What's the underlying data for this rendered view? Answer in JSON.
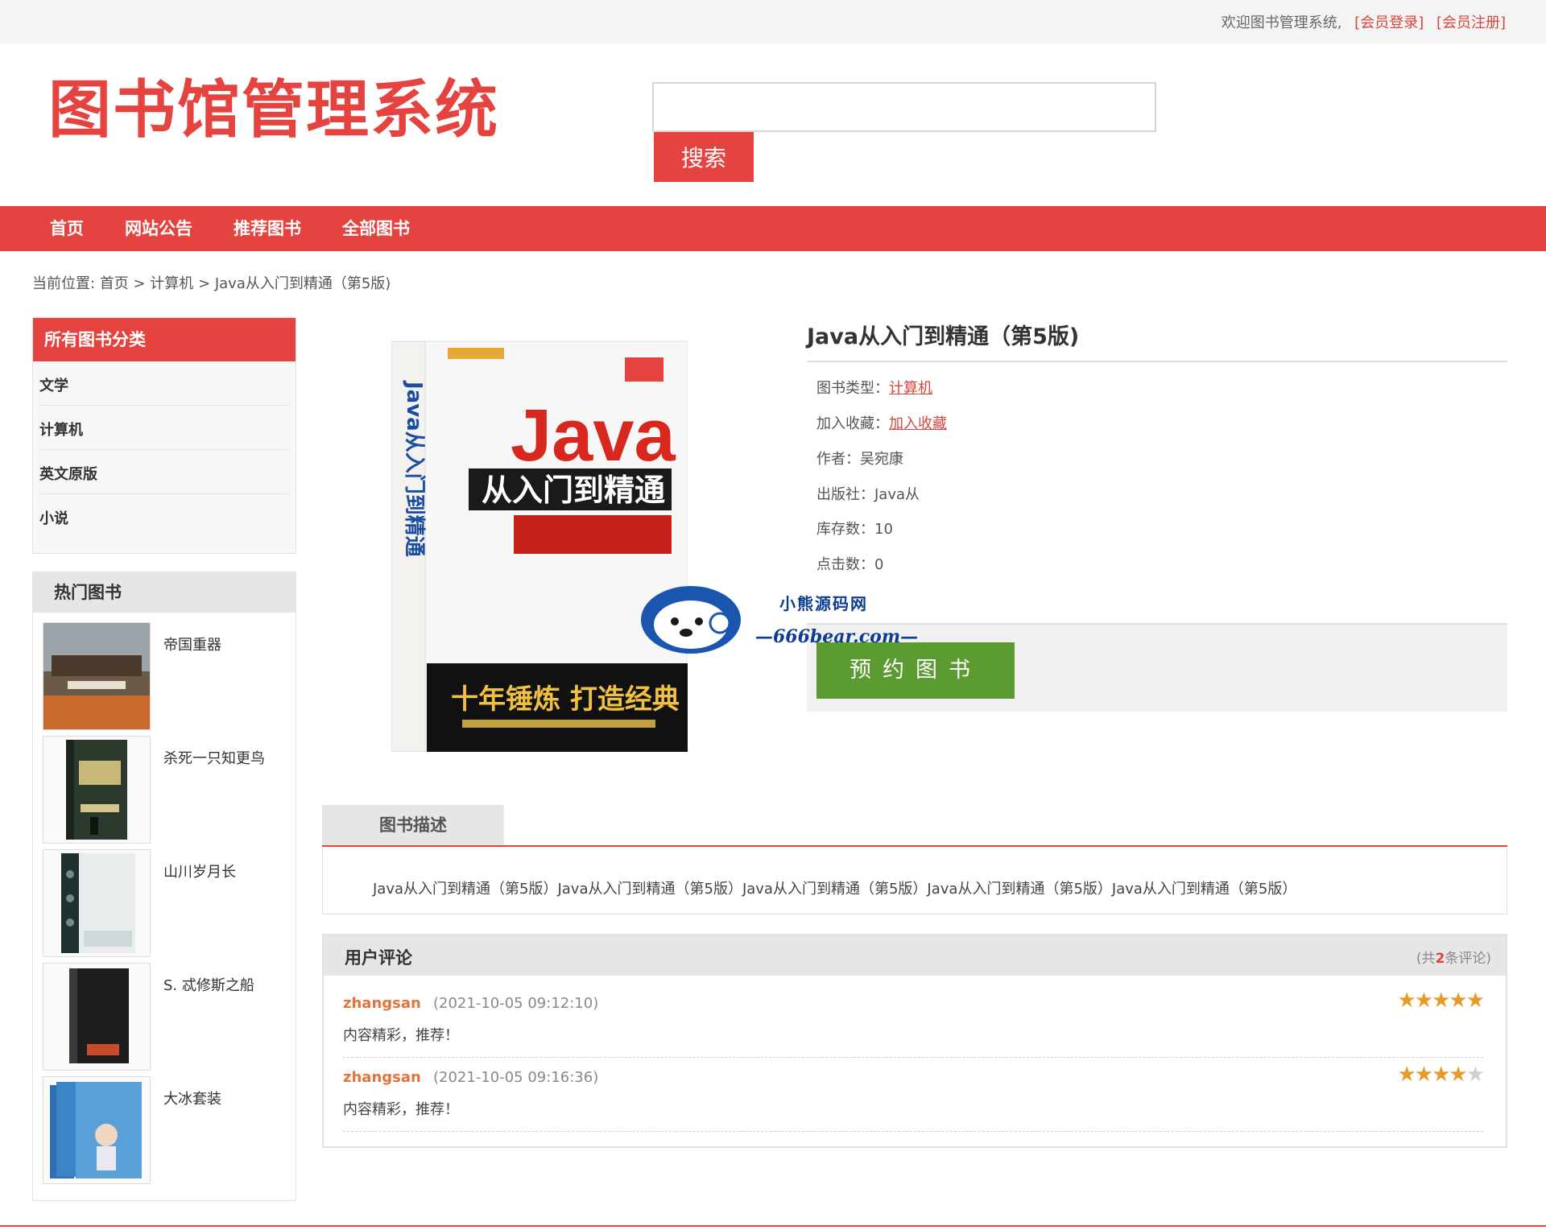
{
  "topbar": {
    "welcome": "欢迎图书管理系统,",
    "login": "[会员登录]",
    "register": "[会员注册]"
  },
  "header": {
    "logo_text": "图书馆管理系统",
    "search_placeholder": "",
    "search_button": "搜索"
  },
  "nav": {
    "items": [
      "首页",
      "网站公告",
      "推荐图书",
      "全部图书"
    ]
  },
  "breadcrumb": "当前位置: 首页 >  计算机 >  Java从入门到精通（第5版)",
  "sidebar": {
    "category_title": "所有图书分类",
    "categories": [
      "文学",
      "计算机",
      "英文原版",
      "小说"
    ],
    "hot_title": "热门图书",
    "hot_books": [
      "帝国重器",
      "杀死一只知更鸟",
      "山川岁月长",
      "S. 忒修斯之船",
      "大冰套装"
    ]
  },
  "book": {
    "title": "Java从入门到精通（第5版)",
    "cover": {
      "spine": "Java从入门到精通",
      "title_big": "Java",
      "subtitle": "从入门到精通",
      "slogan": "十年锤炼 打造经典"
    },
    "type_label": "图书类型：",
    "type_value": "计算机",
    "fav_label": "加入收藏：",
    "fav_value": "加入收藏",
    "author_label": "作者：",
    "author_value": "吴宛康",
    "publisher_label": "出版社：",
    "publisher_value": "Java从",
    "stock_label": "库存数：",
    "stock_value": "10",
    "clicks_label": "点击数：",
    "clicks_value": "0",
    "reserve_button": "预约图书"
  },
  "watermark": {
    "line1": "小熊源码网",
    "line2": "—666bear.com—"
  },
  "description": {
    "tab": "图书描述",
    "text": "Java从入门到精通（第5版）Java从入门到精通（第5版）Java从入门到精通（第5版）Java从入门到精通（第5版）Java从入门到精通（第5版）"
  },
  "comments": {
    "title": "用户评论",
    "count_prefix": "(共",
    "count": "2",
    "count_suffix": "条评论)",
    "items": [
      {
        "user": "zhangsan",
        "time": "(2021-10-05 09:12:10)",
        "text": "内容精彩，推荐！",
        "rating": 5
      },
      {
        "user": "zhangsan",
        "time": "(2021-10-05 09:16:36)",
        "text": "内容精彩，推荐！",
        "rating": 4
      }
    ]
  },
  "colors": {
    "brand_red": "#e5433f",
    "reserve_green": "#5c9b32",
    "username_orange": "#e2733c",
    "star": "#e79a2a"
  }
}
